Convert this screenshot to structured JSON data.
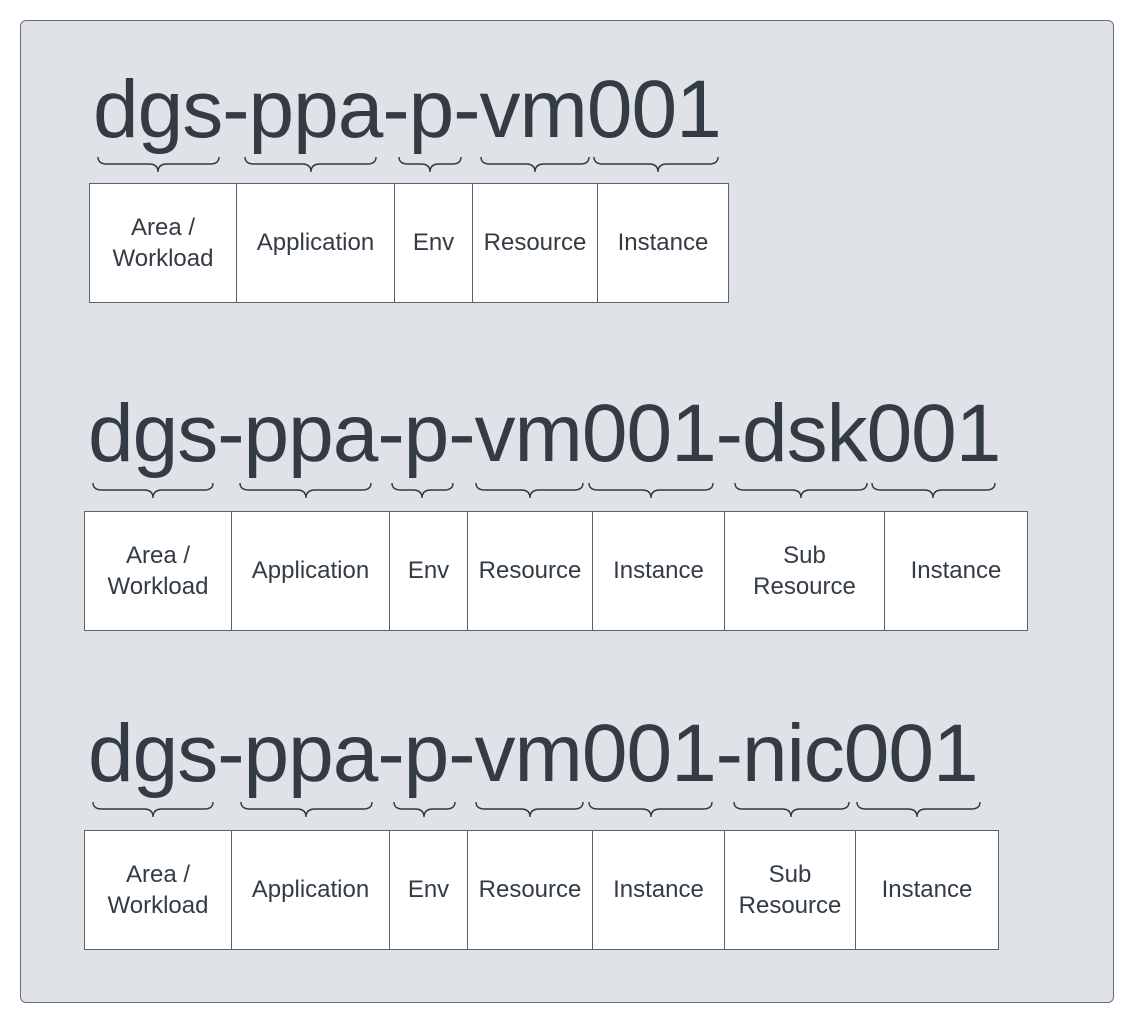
{
  "diagrams": [
    {
      "name": "dgs-ppa-p-vm001",
      "segments": [
        "Area /\nWorkload",
        "Application",
        "Env",
        "Resource",
        "Instance"
      ]
    },
    {
      "name": "dgs-ppa-p-vm001-dsk001",
      "segments": [
        "Area /\nWorkload",
        "Application",
        "Env",
        "Resource",
        "Instance",
        "Sub\nResource",
        "Instance"
      ]
    },
    {
      "name": "dgs-ppa-p-vm001-nic001",
      "segments": [
        "Area /\nWorkload",
        "Application",
        "Env",
        "Resource",
        "Instance",
        "Sub\nResource",
        "Instance"
      ]
    }
  ],
  "colors": {
    "panel_background": "#dfe2e7",
    "panel_border": "#6b6f75",
    "text": "#333b45",
    "cell_background": "#ffffff",
    "cell_border": "#5d6168"
  }
}
